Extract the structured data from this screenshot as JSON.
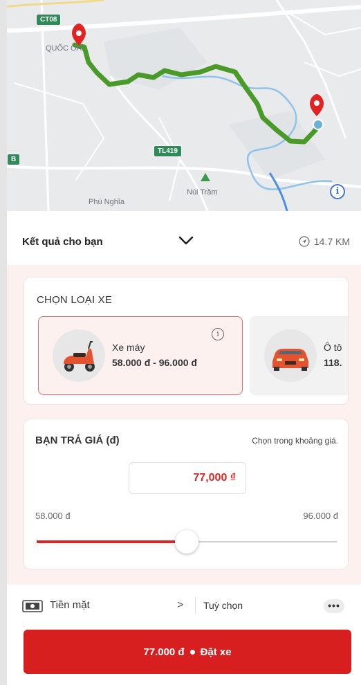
{
  "map": {
    "labels": {
      "quoc_oai": "QUỐC OAI",
      "phu_nghia": "Phú Nghĩa",
      "nui_tram": "Núi Trầm"
    },
    "road_badges": {
      "ct08": "CT08",
      "tl419": "TL419",
      "edge": "B"
    },
    "info_icon": "i"
  },
  "results": {
    "title": "Kết quả cho bạn",
    "distance": "14.7 KM"
  },
  "vehicle": {
    "section_title": "CHỌN LOẠI XE",
    "options": [
      {
        "name": "Xe máy",
        "price": "58.000 đ - 96.000 đ",
        "icon": "scooter-icon",
        "selected": true
      },
      {
        "name": "Ô tô",
        "price": "118.",
        "icon": "car-icon",
        "selected": false
      }
    ],
    "info_icon": "i"
  },
  "price": {
    "title": "BẠN TRẢ GIÁ (đ)",
    "hint": "Chọn trong khoảng giá.",
    "value": "77,000 ₫",
    "min_label": "58.000 đ",
    "max_label": "96.000 đ",
    "slider": {
      "min": 58000,
      "max": 96000,
      "value": 77000
    }
  },
  "payment": {
    "method": "Tiền mặt",
    "chevron": ">",
    "options": "Tuỳ chọn",
    "more": "•••"
  },
  "book": {
    "amount": "77.000 đ",
    "label": "Đặt xe"
  },
  "colors": {
    "accent": "#d81f1f",
    "route": "#4a9a2a",
    "sheet_bg": "#fcf1ef",
    "selected_border": "#e36b6b"
  }
}
